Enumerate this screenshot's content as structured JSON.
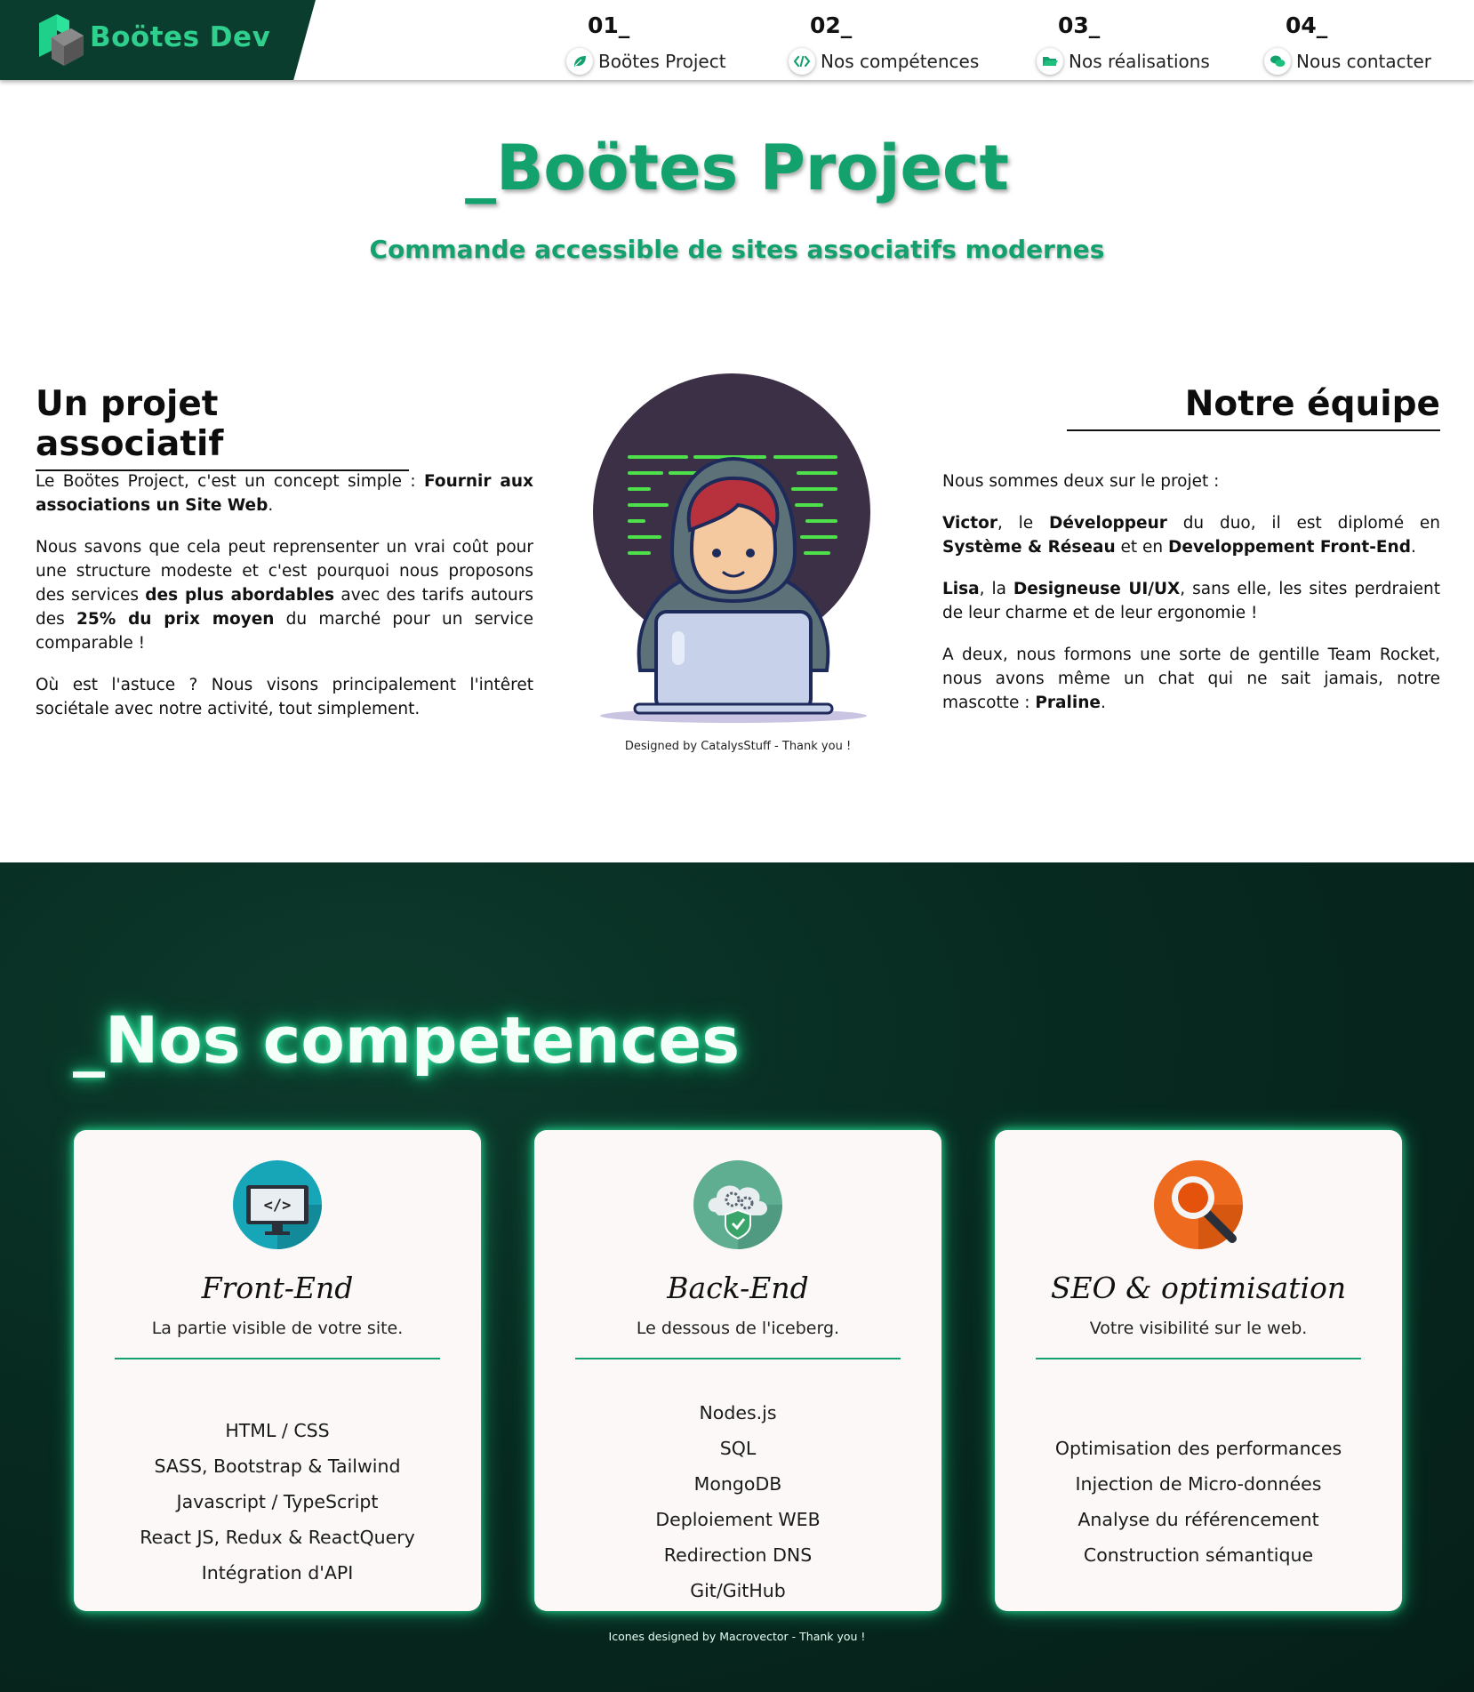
{
  "header": {
    "brand": "Boötes Dev",
    "nav": [
      {
        "num": "01_",
        "label": "Boötes Project",
        "icon": "leaf-icon"
      },
      {
        "num": "02_",
        "label": "Nos compétences",
        "icon": "code-icon"
      },
      {
        "num": "03_",
        "label": "Nos réalisations",
        "icon": "folder-icon"
      },
      {
        "num": "04_",
        "label": "Nous contacter",
        "icon": "chat-icon"
      }
    ]
  },
  "hero": {
    "title": "_Boötes Project",
    "subtitle": "Commande accessible de sites associatifs modernes"
  },
  "project": {
    "title": "Un projet associatif",
    "p1a": "Le Boötes Project, c'est un concept simple : ",
    "p1b": "Fournir aux associations un Site Web",
    "p1c": ".",
    "p2a": "Nous savons que cela peut reprensenter un vrai coût pour une structure modeste et c'est pourquoi nous proposons des services ",
    "p2b": "des plus abordables",
    "p2c": " avec des tarifs autours des ",
    "p2d": "25% du prix moyen",
    "p2e": " du marché pour un service comparable !",
    "p3": "Où est l'astuce ? Nous visons principalement l'intêret sociétale avec notre activité, tout simplement."
  },
  "illustration": {
    "credit": "Designed by CatalysStuff - Thank you !"
  },
  "team": {
    "title": "Notre équipe",
    "p1": "Nous sommes deux sur le projet :",
    "p2a": "Victor",
    "p2b": ", le ",
    "p2c": "Développeur",
    "p2d": " du duo, il est diplomé en ",
    "p2e": "Système & Réseau",
    "p2f": " et en ",
    "p2g": "Developpement Front-End",
    "p2h": ".",
    "p3a": "Lisa",
    "p3b": ", la ",
    "p3c": "Designeuse UI/UX",
    "p3d": ", sans elle, les sites perdraient de leur charme et de leur ergonomie !",
    "p4a": "A deux, nous formons une sorte de gentille Team Rocket, nous avons même un chat qui ne sait jamais, notre mascotte : ",
    "p4b": "Praline",
    "p4c": "."
  },
  "competences": {
    "title": "_Nos competences",
    "credit": "Icones designed by Macrovector - Thank you !",
    "cards": [
      {
        "icon": "monitor-code-icon",
        "title": "Front-End",
        "subtitle": "La partie visible de votre site.",
        "items": [
          "HTML / CSS",
          "SASS, Bootstrap & Tailwind",
          "Javascript / TypeScript",
          "React JS, Redux & ReactQuery",
          "Intégration d'API"
        ]
      },
      {
        "icon": "cloud-gears-shield-icon",
        "title": "Back-End",
        "subtitle": "Le dessous de l'iceberg.",
        "items": [
          "Nodes.js",
          "SQL",
          "MongoDB",
          "Deploiement WEB",
          "Redirection DNS",
          "Git/GitHub"
        ]
      },
      {
        "icon": "magnifier-icon",
        "title": "SEO & optimisation",
        "subtitle": "Votre visibilité sur le web.",
        "items": [
          "Optimisation des performances",
          "Injection de Micro-données",
          "Analyse du référencement",
          "Construction sémantique"
        ]
      }
    ]
  },
  "colors": {
    "brand_green": "#13a16d",
    "logo_green": "#2fd08e",
    "dark_bg": "#072a20",
    "glow": "#22d68f"
  }
}
